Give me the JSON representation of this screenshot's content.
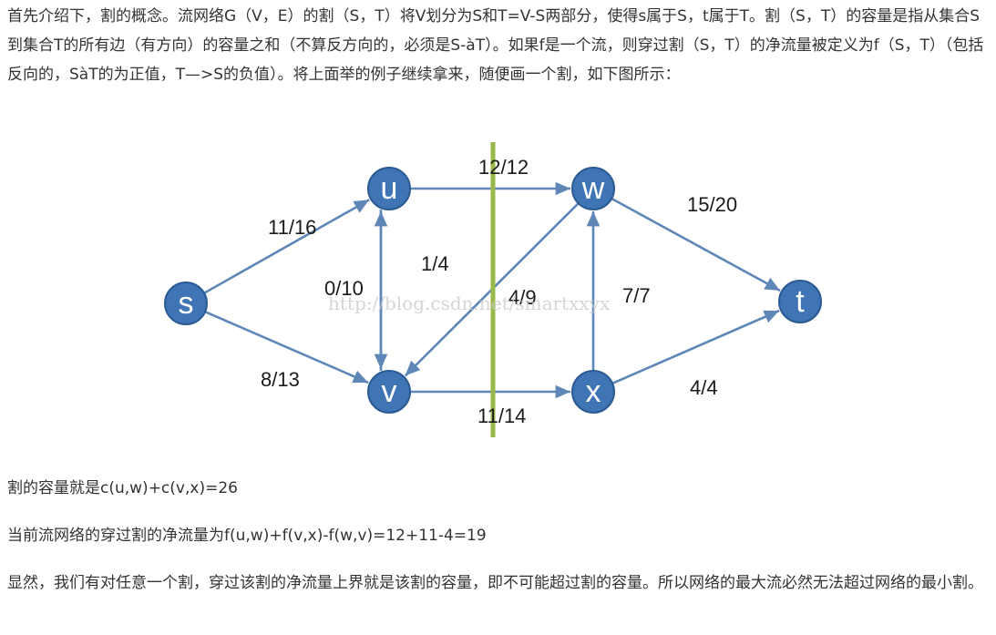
{
  "paragraphs": {
    "intro": "首先介绍下，割的概念。流网络G（V，E）的割（S，T）将V划分为S和T=V-S两部分，使得s属于S，t属于T。割（S，T）的容量是指从集合S到集合T的所有边（有方向）的容量之和（不算反方向的，必须是S-àT）。如果f是一个流，则穿过割（S，T）的净流量被定义为f（S，T）（包括反向的，SàT的为正值，T—>S的负值）。将上面举的例子继续拿来，随便画一个割，如下图所示：",
    "capacity": "割的容量就是c(u,w)+c(v,x)=26",
    "netflow": "当前流网络的穿过割的净流量为f(u,w)+f(v,x)-f(w,v)=12+11-4=19",
    "conclusion": "显然，我们有对任意一个割，穿过该割的净流量上界就是该割的容量，即不可能超过割的容量。所以网络的最大流必然无法超过网络的最小割。"
  },
  "diagram": {
    "watermark": "http://blog.csdn.net/smartxxyx",
    "nodes": [
      {
        "id": "s",
        "label": "s"
      },
      {
        "id": "u",
        "label": "u"
      },
      {
        "id": "v",
        "label": "v"
      },
      {
        "id": "w",
        "label": "w"
      },
      {
        "id": "x",
        "label": "x"
      },
      {
        "id": "t",
        "label": "t"
      }
    ],
    "edges": [
      {
        "from": "s",
        "to": "u",
        "label": "11/16"
      },
      {
        "from": "s",
        "to": "v",
        "label": "8/13"
      },
      {
        "from": "u",
        "to": "w",
        "label": "12/12"
      },
      {
        "from": "v",
        "to": "u",
        "label": "1/4"
      },
      {
        "from": "u",
        "to": "v",
        "label": "0/10"
      },
      {
        "from": "w",
        "to": "v",
        "label": "4/9"
      },
      {
        "from": "v",
        "to": "x",
        "label": "11/14"
      },
      {
        "from": "x",
        "to": "w",
        "label": "7/7"
      },
      {
        "from": "w",
        "to": "t",
        "label": "15/20"
      },
      {
        "from": "x",
        "to": "t",
        "label": "4/4"
      }
    ],
    "colors": {
      "node_fill": "#3f74b5",
      "edge": "#5e87b8",
      "cut": "#98b84a"
    }
  }
}
